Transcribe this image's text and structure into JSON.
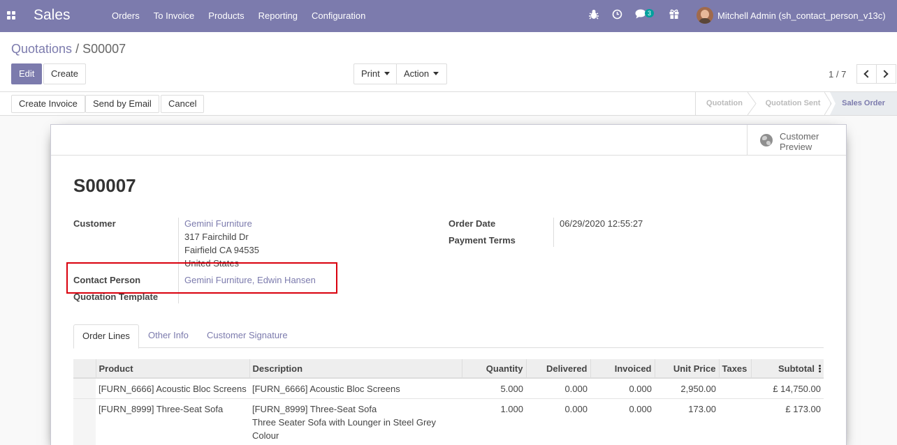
{
  "navbar": {
    "app_name": "Sales",
    "menu": [
      "Orders",
      "To Invoice",
      "Products",
      "Reporting",
      "Configuration"
    ],
    "chat_count": "3",
    "user": "Mitchell Admin (sh_contact_person_v13c)",
    "icons": [
      "apps-grid-icon",
      "bug-icon",
      "clock-icon",
      "chat-icon",
      "gift-icon"
    ]
  },
  "breadcrumb": {
    "parent": "Quotations",
    "separator": "/",
    "current": "S00007"
  },
  "actions": {
    "edit": "Edit",
    "create": "Create",
    "print": "Print",
    "action": "Action"
  },
  "pager": {
    "value": "1 / 7"
  },
  "status_bar": {
    "buttons": [
      "Create Invoice",
      "Send by Email",
      "Cancel"
    ],
    "stages": [
      "Quotation",
      "Quotation Sent",
      "Sales Order"
    ],
    "active_stage": "Sales Order"
  },
  "sheet": {
    "preview_button": "Customer Preview",
    "title": "S00007",
    "customer_label": "Customer",
    "customer_name": "Gemini Furniture",
    "address": [
      "317 Fairchild Dr",
      "Fairfield CA 94535",
      "United States"
    ],
    "contact_label": "Contact Person",
    "contact_value": "Gemini Furniture, Edwin Hansen",
    "template_label": "Quotation Template",
    "order_date_label": "Order Date",
    "order_date": "06/29/2020 12:55:27",
    "payment_terms_label": "Payment Terms"
  },
  "tabs": [
    "Order Lines",
    "Other Info",
    "Customer Signature"
  ],
  "table": {
    "columns": [
      "Product",
      "Description",
      "Quantity",
      "Delivered",
      "Invoiced",
      "Unit Price",
      "Taxes",
      "Subtotal"
    ],
    "rows": [
      {
        "product": "[FURN_6666] Acoustic Bloc Screens",
        "description": [
          "[FURN_6666] Acoustic Bloc Screens"
        ],
        "quantity": "5.000",
        "delivered": "0.000",
        "invoiced": "0.000",
        "unit_price": "2,950.00",
        "taxes": "",
        "subtotal": "£ 14,750.00"
      },
      {
        "product": "[FURN_8999] Three-Seat Sofa",
        "description": [
          "[FURN_8999] Three-Seat Sofa",
          "Three Seater Sofa with Lounger in Steel Grey",
          "Colour"
        ],
        "quantity": "1.000",
        "delivered": "0.000",
        "invoiced": "0.000",
        "unit_price": "173.00",
        "taxes": "",
        "subtotal": "£ 173.00"
      }
    ]
  },
  "colors": {
    "brand": "#7c7bad",
    "highlight": "#d9000d",
    "badge": "#00a09d"
  }
}
